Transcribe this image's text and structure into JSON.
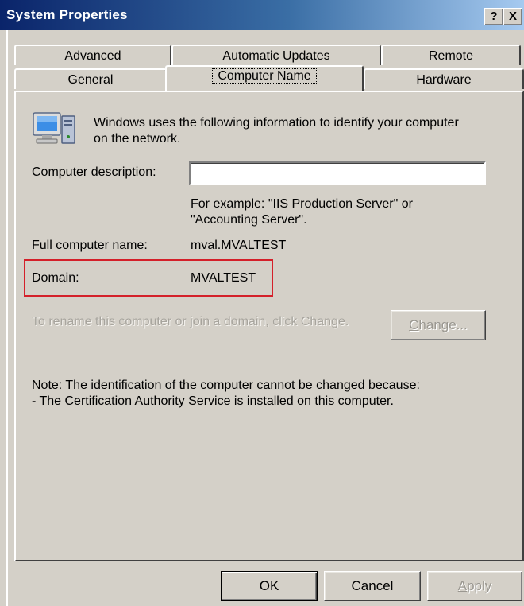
{
  "window": {
    "title": "System Properties",
    "help_glyph": "?",
    "close_glyph": "X"
  },
  "tabs": {
    "row1": [
      "Advanced",
      "Automatic Updates",
      "Remote"
    ],
    "row2": [
      "General",
      "Computer Name",
      "Hardware"
    ],
    "active": "Computer Name"
  },
  "panel": {
    "intro_line1": "Windows uses the following information to identify your computer",
    "intro_line2": "on the network.",
    "description_label_pre": "Computer ",
    "description_label_accel": "d",
    "description_label_post": "escription:",
    "description_value": "",
    "example_line1": "For example: \"IIS Production Server\" or",
    "example_line2": "\"Accounting Server\".",
    "full_name_label": "Full computer name:",
    "full_name_value": "mval.MVALTEST",
    "domain_label": "Domain:",
    "domain_value": "MVALTEST",
    "rename_text": "To rename this computer or join a domain, click Change.",
    "change_button_accel": "C",
    "change_button_rest": "hange...",
    "note_line1": "Note: The identification of the computer cannot be changed because:",
    "note_line2": "- The Certification Authority Service is installed on this computer."
  },
  "buttons": {
    "ok": "OK",
    "cancel": "Cancel",
    "apply_accel": "A",
    "apply_rest": "pply"
  },
  "colors": {
    "dialog_bg": "#d4d0c8",
    "titlebar_start": "#0a246a",
    "titlebar_end": "#a6caf0",
    "highlight_box": "#d4202a",
    "disabled_text": "#9a9790"
  },
  "icons": {
    "computer": "computer-icon"
  }
}
